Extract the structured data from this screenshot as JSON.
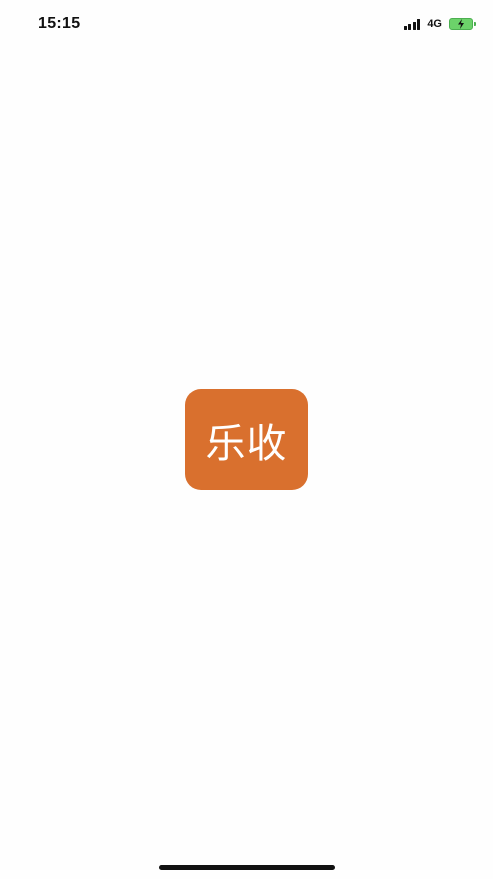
{
  "status_bar": {
    "time": "15:15",
    "network": "4G",
    "signal_icon": "signal-bars-icon",
    "battery_icon": "battery-charging-icon"
  },
  "splash": {
    "logo_text": "乐收",
    "logo_color": "#d9702e",
    "logo_text_color": "#ffffff",
    "background": "#fefefe"
  }
}
